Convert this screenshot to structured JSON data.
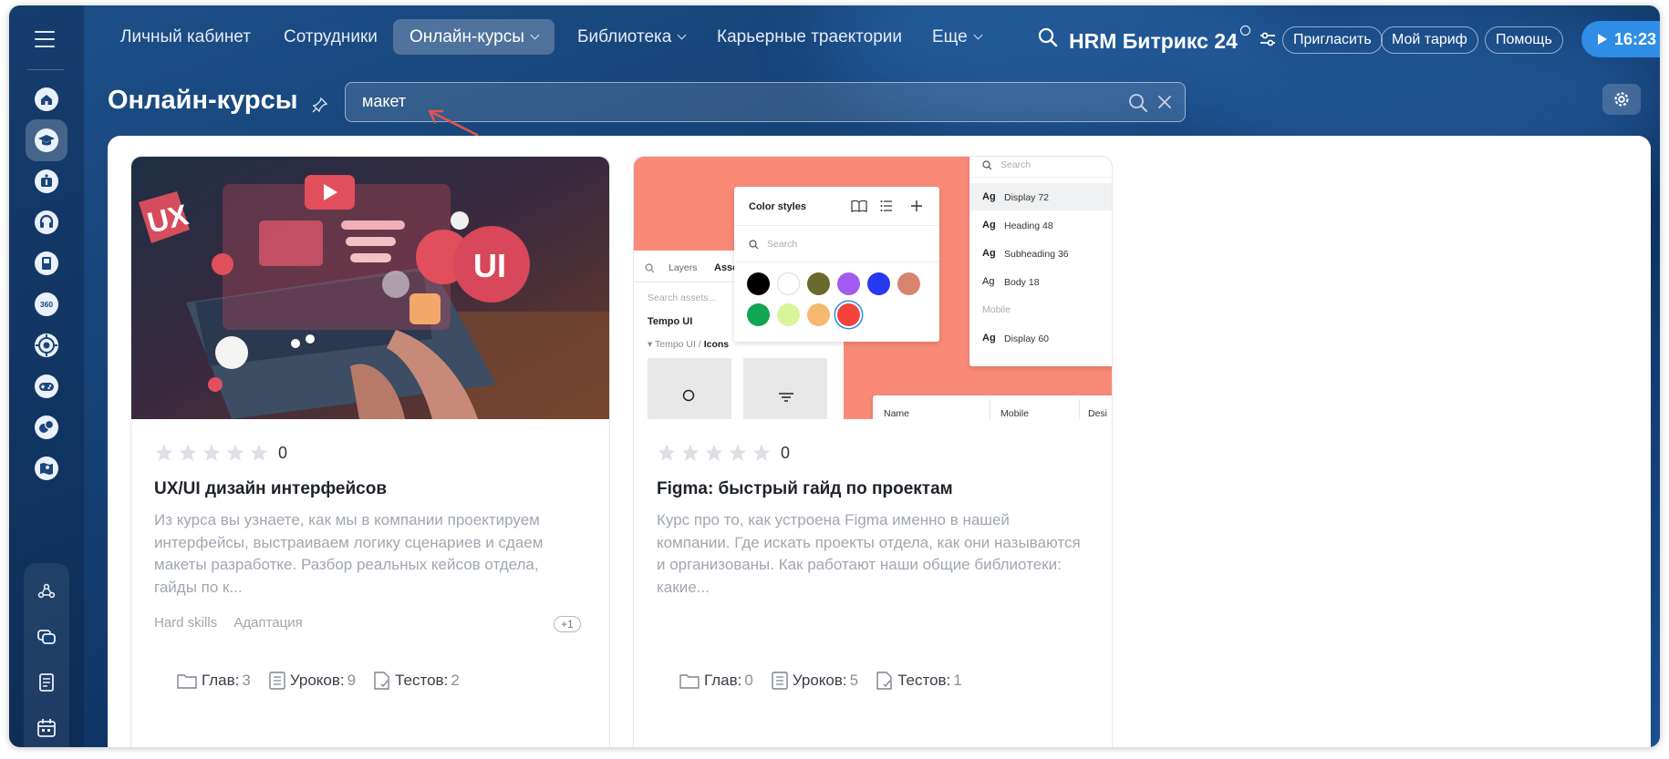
{
  "topnav": {
    "items": [
      {
        "label": "Личный кабинет"
      },
      {
        "label": "Сотрудники"
      },
      {
        "label": "Онлайн-курсы"
      },
      {
        "label": "Библиотека"
      },
      {
        "label": "Карьерные траектории"
      },
      {
        "label": "Еще"
      }
    ],
    "brand": "HRM Битрикс 24",
    "invite_label": "Пригласить",
    "tariff_label": "Мой тариф",
    "help_label": "Помощь",
    "time": "16:23"
  },
  "page": {
    "title": "Онлайн-курсы",
    "search_value": "макет"
  },
  "colors": {
    "accent": "#2f8de6",
    "background": "#164377",
    "figma_coral": "#f98a78"
  },
  "sidebar": {
    "icons": [
      "menu-icon",
      "home-icon",
      "graduation-cap-icon",
      "info-icon",
      "headset-icon",
      "book-icon",
      "360-icon",
      "target-icon",
      "gamepad-icon",
      "chat-bubbles-icon",
      "map-icon",
      "workflow-icon",
      "messages-icon",
      "document-icon",
      "calendar-icon"
    ]
  },
  "courses": [
    {
      "title": "UX/UI дизайн интерфейсов",
      "rating_count": "0",
      "description": "Из курса вы узнаете, как мы в компании проектируем интерфейсы, выстраиваем логику сценариев и сдаем макеты разработке. Разбор реальных кейсов отдела, гайды по к...",
      "tags": [
        "Hard skills",
        "Адаптация"
      ],
      "more_tags": "+1",
      "stats": {
        "chapters_label": "Глав:",
        "chapters": "3",
        "lessons_label": "Уроков:",
        "lessons": "9",
        "tests_label": "Тестов:",
        "tests": "2"
      }
    },
    {
      "title": "Figma: быстрый гайд по проектам",
      "rating_count": "0",
      "description": "Курс про то, как устроена Figma именно в нашей компании. Где искать проекты отдела, как они называются и организованы. Как работают наши общие библиотеки: какие...",
      "stats": {
        "chapters_label": "Глав:",
        "chapters": "0",
        "lessons_label": "Уроков:",
        "lessons": "5",
        "tests_label": "Тестов:",
        "tests": "1"
      }
    }
  ],
  "figma_cover": {
    "color_styles": "Color styles",
    "search": "Search",
    "layers": "Layers",
    "assets": "Assets",
    "search_assets": "Search assets...",
    "tempo_ui": "Tempo UI",
    "tempo_icons_path": "Tempo UI / ",
    "tempo_icons_bold": "Icons",
    "type_styles": [
      {
        "ag": "Ag",
        "name": "Display 72"
      },
      {
        "ag": "Ag",
        "name": "Heading 48"
      },
      {
        "ag": "Ag",
        "name": "Subheading 36"
      },
      {
        "ag": "Ag",
        "name": "Body 18"
      }
    ],
    "mobile_group": "Mobile",
    "mobile_style": {
      "ag": "Ag",
      "name": "Display 60"
    },
    "table_cols": [
      "Name",
      "Mobile",
      "Desi"
    ],
    "swatches": [
      "#000000",
      "#ffffff",
      "#6b6a2e",
      "#a35bef",
      "#2838f0",
      "#d98470",
      "#12a552",
      "#d9f59a",
      "#f6b76e",
      "#f2443a"
    ]
  },
  "uxui_cover": {
    "badge_ux": "UX",
    "badge_ui": "UI"
  }
}
